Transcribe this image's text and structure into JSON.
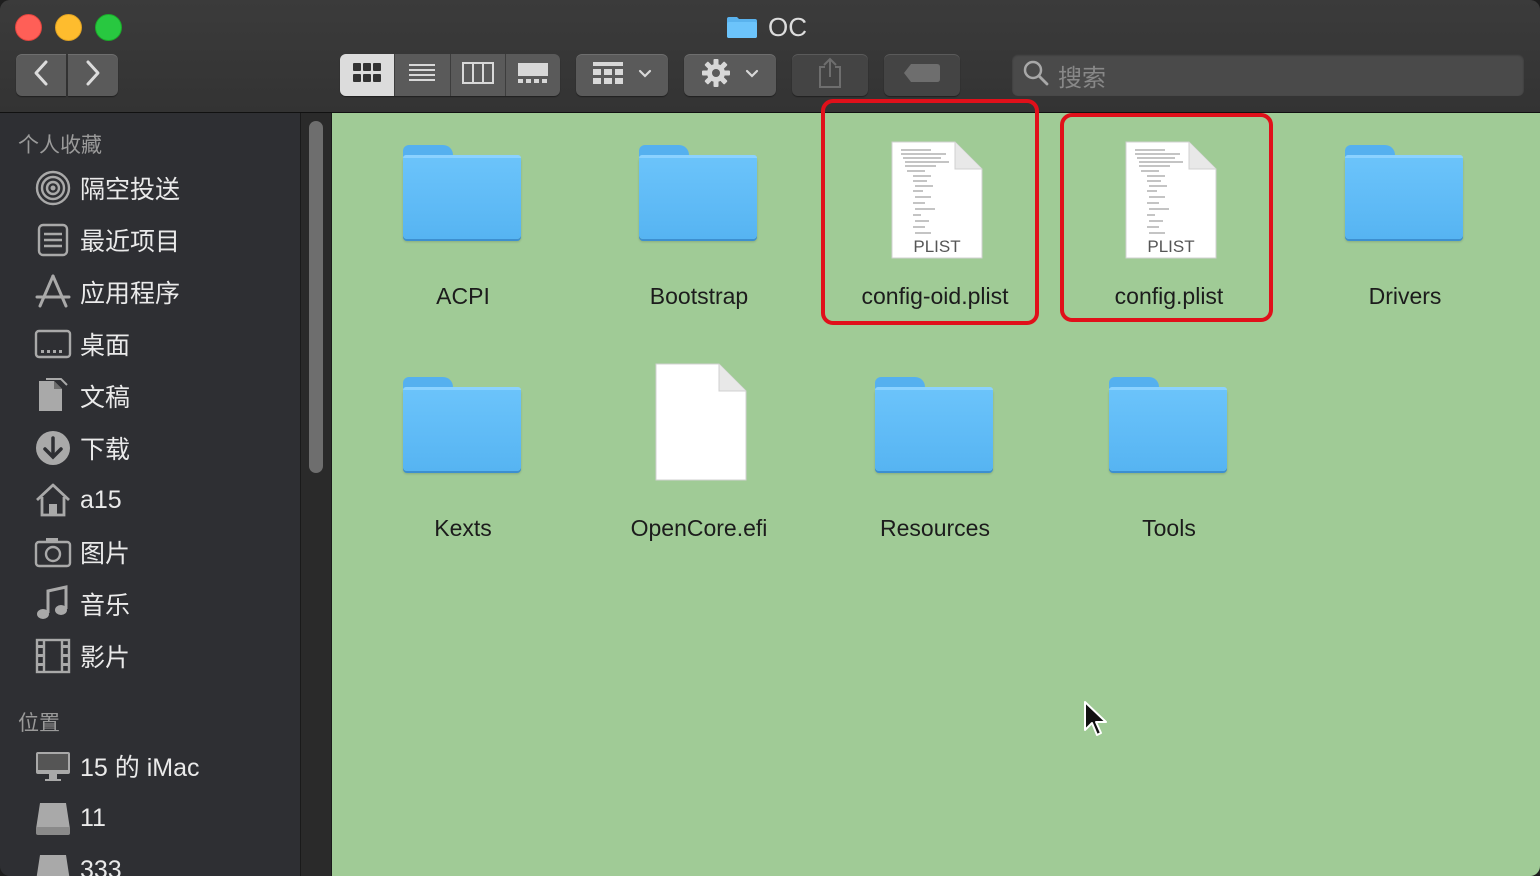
{
  "window": {
    "title": "OC"
  },
  "toolbar": {
    "search_placeholder": "搜索",
    "icons": {
      "back": "chevron-left-icon",
      "forward": "chevron-right-icon",
      "icon_view": "icon-grid-view-icon",
      "list_view": "list-view-icon",
      "column_view": "column-view-icon",
      "gallery_view": "gallery-view-icon",
      "group": "group-by-icon",
      "action": "gear-icon",
      "share": "share-icon",
      "tag": "tag-icon",
      "search": "search-icon"
    }
  },
  "sidebar": {
    "favorites_header": "个人收藏",
    "favorites": [
      {
        "label": "隔空投送",
        "icon": "airdrop-icon"
      },
      {
        "label": "最近项目",
        "icon": "recents-icon"
      },
      {
        "label": "应用程序",
        "icon": "applications-icon"
      },
      {
        "label": "桌面",
        "icon": "desktop-icon"
      },
      {
        "label": "文稿",
        "icon": "documents-icon"
      },
      {
        "label": "下载",
        "icon": "downloads-icon"
      },
      {
        "label": "a15",
        "icon": "home-icon"
      },
      {
        "label": "图片",
        "icon": "pictures-icon"
      },
      {
        "label": "音乐",
        "icon": "music-icon"
      },
      {
        "label": "影片",
        "icon": "movies-icon"
      }
    ],
    "locations_header": "位置",
    "locations": [
      {
        "label": "15 的 iMac",
        "icon": "imac-icon"
      },
      {
        "label": "11",
        "icon": "disk-icon"
      },
      {
        "label": "333",
        "icon": "disk-icon"
      }
    ]
  },
  "content": {
    "items": [
      {
        "name": "ACPI",
        "type": "folder"
      },
      {
        "name": "Bootstrap",
        "type": "folder"
      },
      {
        "name": "config-oid.plist",
        "type": "plist",
        "badge": "PLIST",
        "highlighted": true
      },
      {
        "name": "config.plist",
        "type": "plist",
        "badge": "PLIST",
        "highlighted": true
      },
      {
        "name": "Drivers",
        "type": "folder"
      },
      {
        "name": "Kexts",
        "type": "folder"
      },
      {
        "name": "OpenCore.efi",
        "type": "file"
      },
      {
        "name": "Resources",
        "type": "folder"
      },
      {
        "name": "Tools",
        "type": "folder"
      }
    ]
  },
  "colors": {
    "content_background": "#a0cb96",
    "folder_blue": "#5cb8f5",
    "highlight_red": "#e0101a",
    "sidebar_background": "#2e2f33"
  }
}
